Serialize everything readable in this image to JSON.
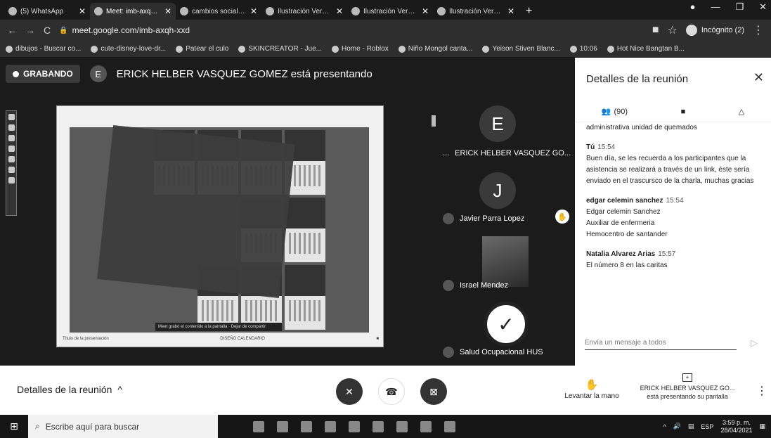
{
  "browser": {
    "tabs": [
      {
        "label": "(5) WhatsApp",
        "active": false
      },
      {
        "label": "Meet: imb-axqh-...",
        "active": true
      },
      {
        "label": "cambios sociales Goo...",
        "active": false
      },
      {
        "label": "Ilustración Verde Día...",
        "active": false
      },
      {
        "label": "Ilustración Verde Día...",
        "active": false
      },
      {
        "label": "Ilustración Verde Día...",
        "active": false
      }
    ],
    "new_tab": "+",
    "url": "meet.google.com/imb-axqh-xxd",
    "incognito_label": "Incógnito (2)",
    "bookmarks": [
      "dibujos - Buscar co...",
      "cute-disney-love-dr...",
      "Patear el culo",
      "SKINCREATOR - Jue...",
      "Home - Roblox",
      "Niño Mongol canta...",
      "Yeison Stiven Blanc...",
      "10:06",
      "Hot Nice Bangtan B..."
    ]
  },
  "meet": {
    "recording_label": "GRABANDO",
    "presenter_initial": "E",
    "presenter_title": "ERICK HELBER VASQUEZ GOMEZ está presentando",
    "slide_banner": "Meet grabó el contenido a la pantalla · Dejar de compartir",
    "slide_footer_left": "Título de la presentación",
    "slide_footer_mid": "DISEÑO CALENDARIO",
    "participants": [
      {
        "initial": "E",
        "name": "ERICK HELBER VASQUEZ GO..."
      },
      {
        "initial": "J",
        "name": "Javier Parra Lopez"
      },
      {
        "initial": "",
        "name": "Israel Mendez"
      },
      {
        "initial": "",
        "name": "Salud Ocupacional HUS"
      }
    ],
    "more_dots": "..."
  },
  "panel": {
    "title": "Detalles de la reunión",
    "people_count": "(90)",
    "messages": [
      {
        "who": "",
        "time": "",
        "body": "administrativa unidad de quemados"
      },
      {
        "who": "Tú",
        "time": "15:54",
        "body": "Buen día, se les recuerda a los participantes que la asistencia se realizará a través de un link, éste sería enviado en el trascurscо de la charla, muchas gracias"
      },
      {
        "who": "edgar celemin sanchez",
        "time": "15:54",
        "body": "Edgar celemin Sanchez\nAuxiliar de enfermeria\nHemocentro de santander"
      },
      {
        "who": "Natalia Alvarez Arias",
        "time": "15:57",
        "body": "El número 8 en las caritas"
      }
    ],
    "input_placeholder": "Envía un mensaje a todos"
  },
  "bottombar": {
    "details_label": "Detalles de la reunión",
    "raise_hand": "Levantar la mano",
    "sharing_name": "ERICK HELBER VASQUEZ GO...",
    "sharing_text": "está presentando su pantalla"
  },
  "taskbar": {
    "search_placeholder": "Escribe aquí para buscar",
    "lang": "ESP",
    "time": "3:59 p. m.",
    "date": "28/04/2021"
  }
}
